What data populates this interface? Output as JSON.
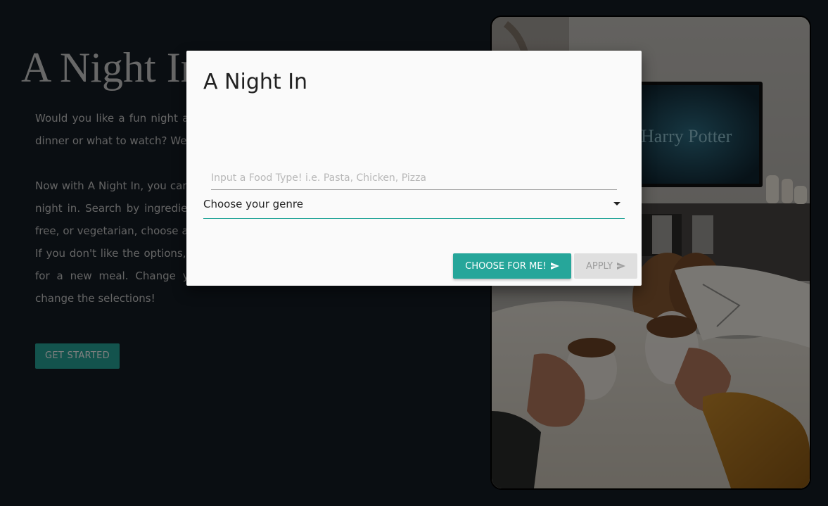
{
  "hero": {
    "title": "A Night In",
    "paragraph1": "Would you like a fun night at home, but don't know what to make for dinner or what to watch? We've got you covered!",
    "paragraph2": "Now with A Night In, you can select a meal and a movie for the perfect night in. Search by ingredient or dietary need such as vegan, gluten free, or vegetarian, choose a genre and let us do the hard part for you! If you don't like the options, you can select the \"I Don't Like It\" button for a new meal. Change your mind? Select the Restart button to change the selections!",
    "cta_label": "GET STARTED"
  },
  "modal": {
    "title": "A Night In",
    "food_input": {
      "value": "",
      "placeholder": "Input a Food Type! i.e. Pasta, Chicken, Pizza"
    },
    "genre_select": {
      "selected": "Choose your genre"
    },
    "choose_label": "CHOOSE FOR ME!",
    "apply_label": "APPLY"
  },
  "colors": {
    "accent": "#26a69a",
    "page_background": "#141c25",
    "modal_background": "#fafafa"
  },
  "icons": {
    "send": "send-icon",
    "dropdown": "caret-down-icon"
  }
}
